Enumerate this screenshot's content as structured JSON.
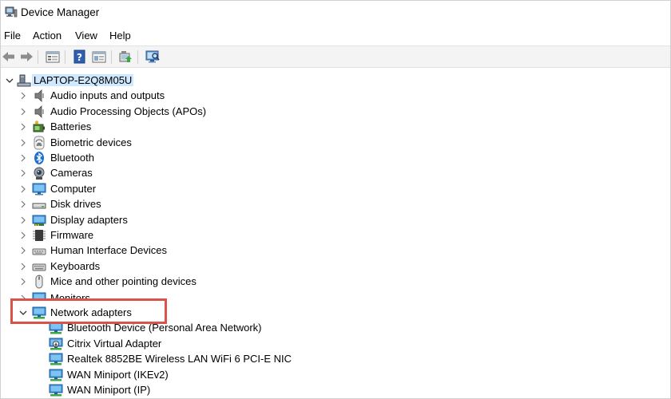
{
  "window": {
    "title": "Device Manager"
  },
  "menu": [
    "File",
    "Action",
    "View",
    "Help"
  ],
  "toolbar": {
    "buttons": [
      "back-icon",
      "forward-icon",
      "properties-icon",
      "help-icon",
      "view-icon",
      "update-driver-icon",
      "scan-hardware-icon"
    ]
  },
  "tree": {
    "root": "LAPTOP-E2Q8M05U",
    "categories": [
      {
        "label": "Audio inputs and outputs",
        "icon": "speaker-icon",
        "expanded": false
      },
      {
        "label": "Audio Processing Objects (APOs)",
        "icon": "speaker-icon",
        "expanded": false
      },
      {
        "label": "Batteries",
        "icon": "battery-icon",
        "expanded": false
      },
      {
        "label": "Biometric devices",
        "icon": "fingerprint-icon",
        "expanded": false
      },
      {
        "label": "Bluetooth",
        "icon": "bluetooth-icon",
        "expanded": false
      },
      {
        "label": "Cameras",
        "icon": "camera-icon",
        "expanded": false
      },
      {
        "label": "Computer",
        "icon": "monitor-icon",
        "expanded": false
      },
      {
        "label": "Disk drives",
        "icon": "disk-drive-icon",
        "expanded": false
      },
      {
        "label": "Display adapters",
        "icon": "display-adapter-icon",
        "expanded": false
      },
      {
        "label": "Firmware",
        "icon": "chip-icon",
        "expanded": false
      },
      {
        "label": "Human Interface Devices",
        "icon": "hid-icon",
        "expanded": false
      },
      {
        "label": "Keyboards",
        "icon": "keyboard-icon",
        "expanded": false
      },
      {
        "label": "Mice and other pointing devices",
        "icon": "mouse-icon",
        "expanded": false
      },
      {
        "label": "Monitors",
        "icon": "monitor-icon",
        "expanded": false
      },
      {
        "label": "Network adapters",
        "icon": "network-adapter-icon",
        "expanded": true
      }
    ],
    "network_adapters": [
      "Bluetooth Device (Personal Area Network)",
      "Citrix Virtual Adapter",
      "Realtek 8852BE Wireless LAN WiFi 6 PCI-E NIC",
      "WAN Miniport (IKEv2)",
      "WAN Miniport (IP)"
    ]
  },
  "colors": {
    "highlight": "#d9534a",
    "selection": "#cde8ff",
    "accent": "#0078d4"
  }
}
